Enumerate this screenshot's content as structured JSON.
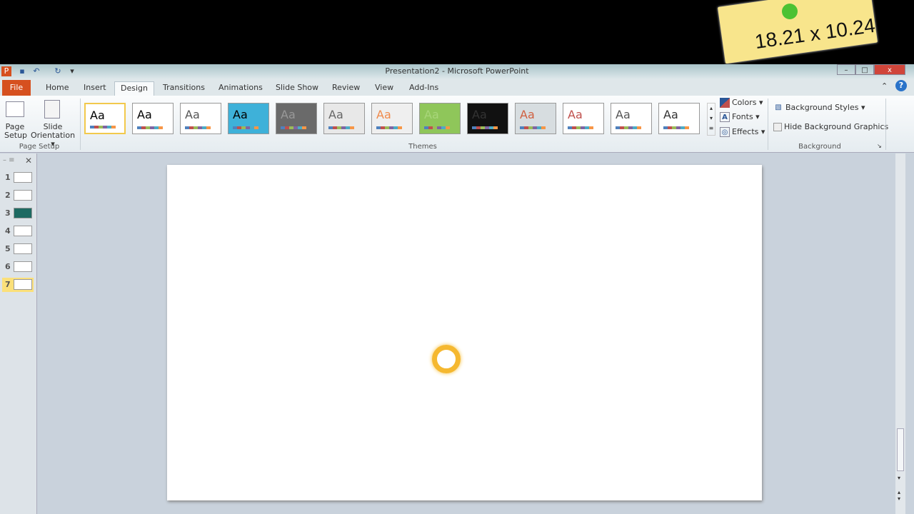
{
  "sticky_note": {
    "text": "18.21 x 10.24"
  },
  "window": {
    "title": "Presentation2 - Microsoft PowerPoint",
    "minimize": "–",
    "maximize": "□",
    "close": "x",
    "help": "?"
  },
  "tabs": [
    {
      "label": "File"
    },
    {
      "label": "Home"
    },
    {
      "label": "Insert"
    },
    {
      "label": "Design"
    },
    {
      "label": "Transitions"
    },
    {
      "label": "Animations"
    },
    {
      "label": "Slide Show"
    },
    {
      "label": "Review"
    },
    {
      "label": "View"
    },
    {
      "label": "Add-Ins"
    }
  ],
  "ribbon": {
    "page_setup": {
      "page_setup": "Page Setup",
      "slide_orientation": "Slide Orientation ▾",
      "label": "Page Setup"
    },
    "themes": {
      "label": "Themes",
      "items": [
        {
          "aa": "Aa",
          "bg": "#ffffff",
          "fg": "#000000"
        },
        {
          "aa": "Aa",
          "bg": "#ffffff",
          "fg": "#000000"
        },
        {
          "aa": "Aa",
          "bg": "#ffffff",
          "fg": "#555555"
        },
        {
          "aa": "Aa",
          "bg": "#3eb1d9",
          "fg": "#000000"
        },
        {
          "aa": "Aa",
          "bg": "#6a6a6a",
          "fg": "#999999"
        },
        {
          "aa": "Aa",
          "bg": "#e8e8e8",
          "fg": "#666666"
        },
        {
          "aa": "Aa",
          "bg": "#efefef",
          "fg": "#f08a4b"
        },
        {
          "aa": "Aa",
          "bg": "#8fc65a",
          "fg": "#a8d67a"
        },
        {
          "aa": "Aa",
          "bg": "#111111",
          "fg": "#333333"
        },
        {
          "aa": "Aa",
          "bg": "#d7dde0",
          "fg": "#d06040"
        },
        {
          "aa": "Aa",
          "bg": "#ffffff",
          "fg": "#c0504d"
        },
        {
          "aa": "Aa",
          "bg": "#ffffff",
          "fg": "#555555"
        },
        {
          "aa": "Aa",
          "bg": "#ffffff",
          "fg": "#333333"
        }
      ],
      "colors": "Colors ▾",
      "fonts": "Fonts ▾",
      "effects": "Effects ▾"
    },
    "background": {
      "styles": "Background Styles ▾",
      "hide_graphics": "Hide Background Graphics",
      "hide_checked": false,
      "label": "Background"
    }
  },
  "slides_panel": {
    "slides": [
      "1",
      "2",
      "3",
      "4",
      "5",
      "6",
      "7"
    ],
    "selected": "7"
  }
}
